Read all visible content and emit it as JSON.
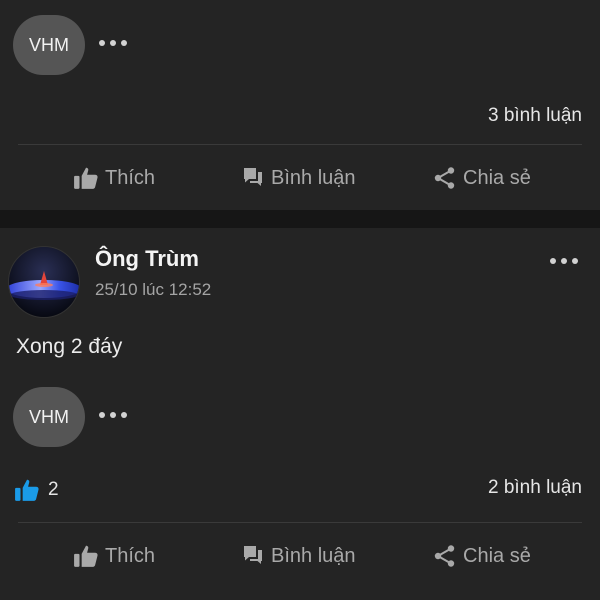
{
  "post1": {
    "reactor_initials": "VHM",
    "comment_count": "3 bình luận",
    "actions": {
      "like": "Thích",
      "comment": "Bình luận",
      "share": "Chia sẻ"
    }
  },
  "post2": {
    "author": "Ông Trùm",
    "timestamp": "25/10 lúc 12:52",
    "text": "Xong 2 đáy",
    "reactor_initials": "VHM",
    "like_count": "2",
    "comment_count": "2 bình luận",
    "actions": {
      "like": "Thích",
      "comment": "Bình luận",
      "share": "Chia sẻ"
    }
  },
  "colors": {
    "background": "#161616",
    "card": "#242424",
    "like_accent": "#1a9be8"
  },
  "icons": [
    "more-dots-icon",
    "thumbs-up-icon",
    "comment-icon",
    "share-icon",
    "like-reaction-icon"
  ]
}
